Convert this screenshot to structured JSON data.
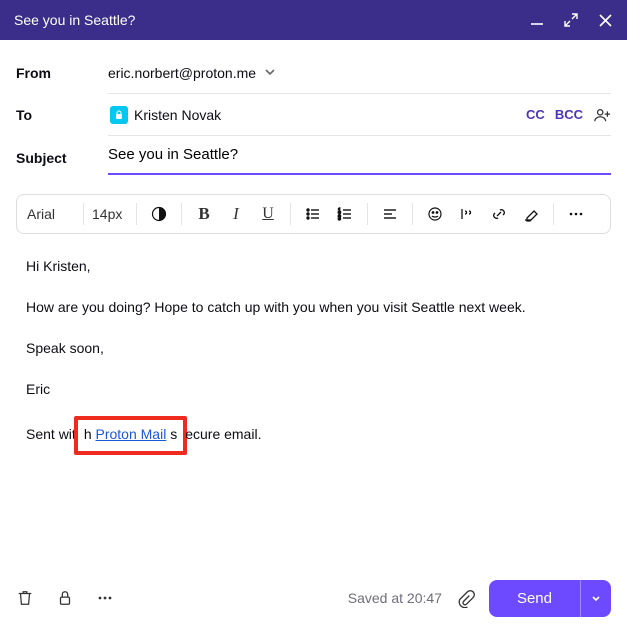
{
  "window": {
    "title": "See you in Seattle?"
  },
  "fields": {
    "from_label": "From",
    "from_value": "eric.norbert@proton.me",
    "to_label": "To",
    "recipient_name": "Kristen Novak",
    "cc": "CC",
    "bcc": "BCC",
    "subject_label": "Subject",
    "subject_value": "See you in Seattle?"
  },
  "toolbar": {
    "font": "Arial",
    "size": "14px",
    "bold": "B",
    "italic": "I",
    "underline": "U"
  },
  "body": {
    "greeting": "Hi Kristen,",
    "p1": "How are you doing? Hope to catch up with you when you visit Seattle next week.",
    "p2": "Speak soon,",
    "sign": "Eric",
    "sig_prefix": "Sent wit",
    "sig_box_pre": "h ",
    "sig_link": "Proton Mail",
    "sig_box_post": " s",
    "sig_suffix": "ecure email."
  },
  "footer": {
    "saved": "Saved at 20:47",
    "send": "Send"
  }
}
